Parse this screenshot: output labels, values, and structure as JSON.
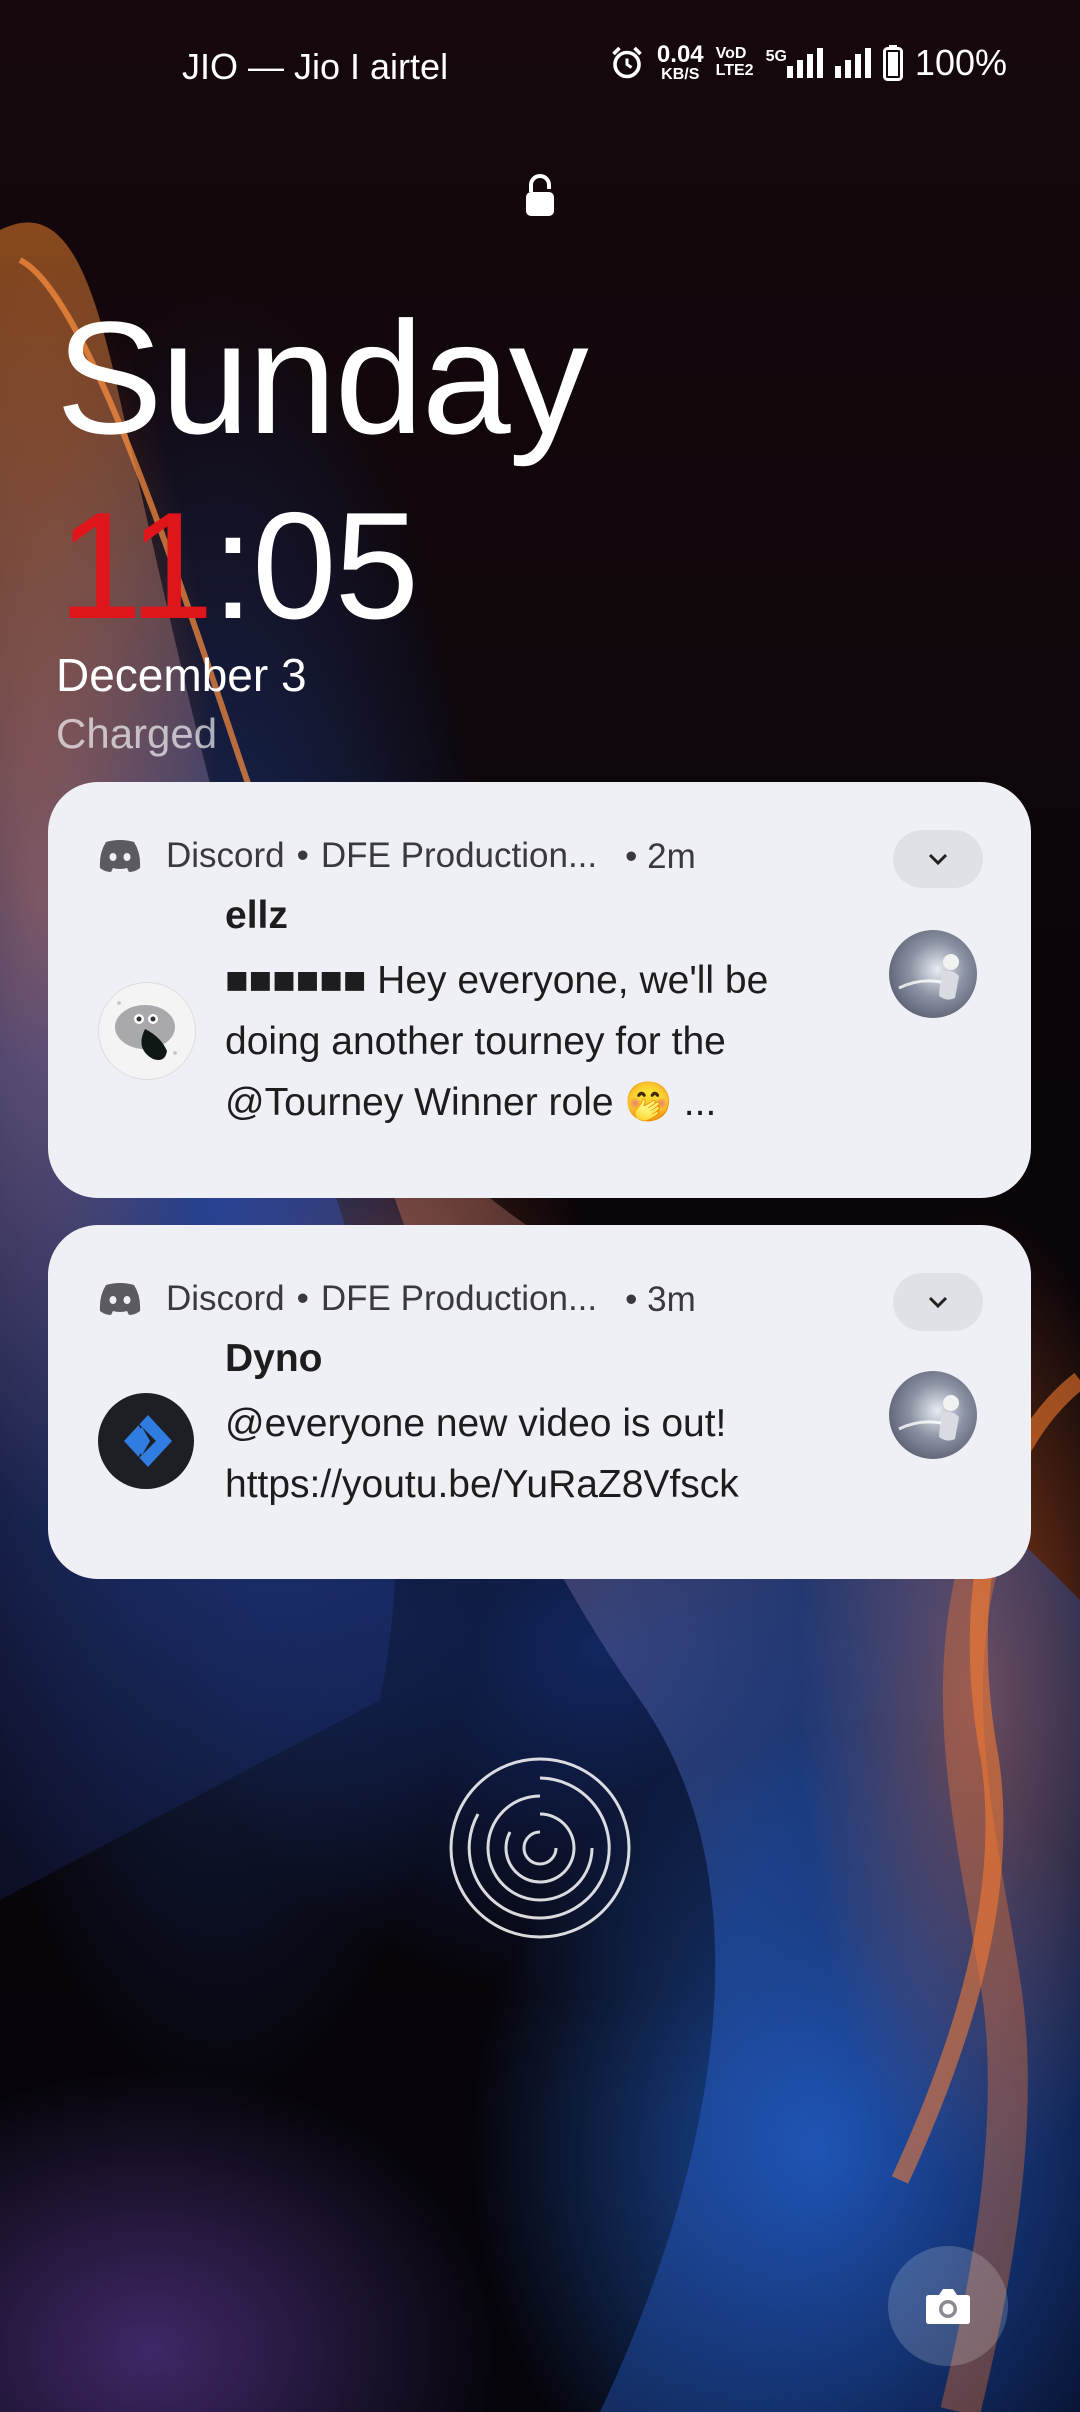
{
  "status_bar": {
    "carrier": "JIO — Jio I airtel",
    "net_speed_value": "0.04",
    "net_speed_unit": "KB/S",
    "volte_top": "VoD",
    "volte_bottom": "LTE2",
    "network_type": "5G",
    "battery": "100%"
  },
  "lockscreen": {
    "day": "Sunday",
    "time_hour": "11",
    "time_sep": ":",
    "time_minute": "05",
    "date": "December 3",
    "charge_status": "Charged"
  },
  "notifications": [
    {
      "app": "Discord",
      "channel": "DFE Production...",
      "age": "2m",
      "sender": "ellz",
      "message": "■■■■■■ Hey everyone, we'll be doing another tourney for the @Tourney Winner  role 🤭 ..."
    },
    {
      "app": "Discord",
      "channel": "DFE Production...",
      "age": "3m",
      "sender": "Dyno",
      "message": "@everyone new video is out! https://youtu.be/YuRaZ8Vfsck"
    }
  ],
  "colors": {
    "clock_hour": "#e0141b",
    "notification_bg": "#eff0f5",
    "dyno_blue": "#2f7de1"
  },
  "icons": [
    "alarm-icon",
    "signal-icon",
    "battery-icon",
    "lock-icon",
    "discord-icon",
    "chevron-down-icon",
    "fingerprint-icon",
    "camera-icon"
  ]
}
